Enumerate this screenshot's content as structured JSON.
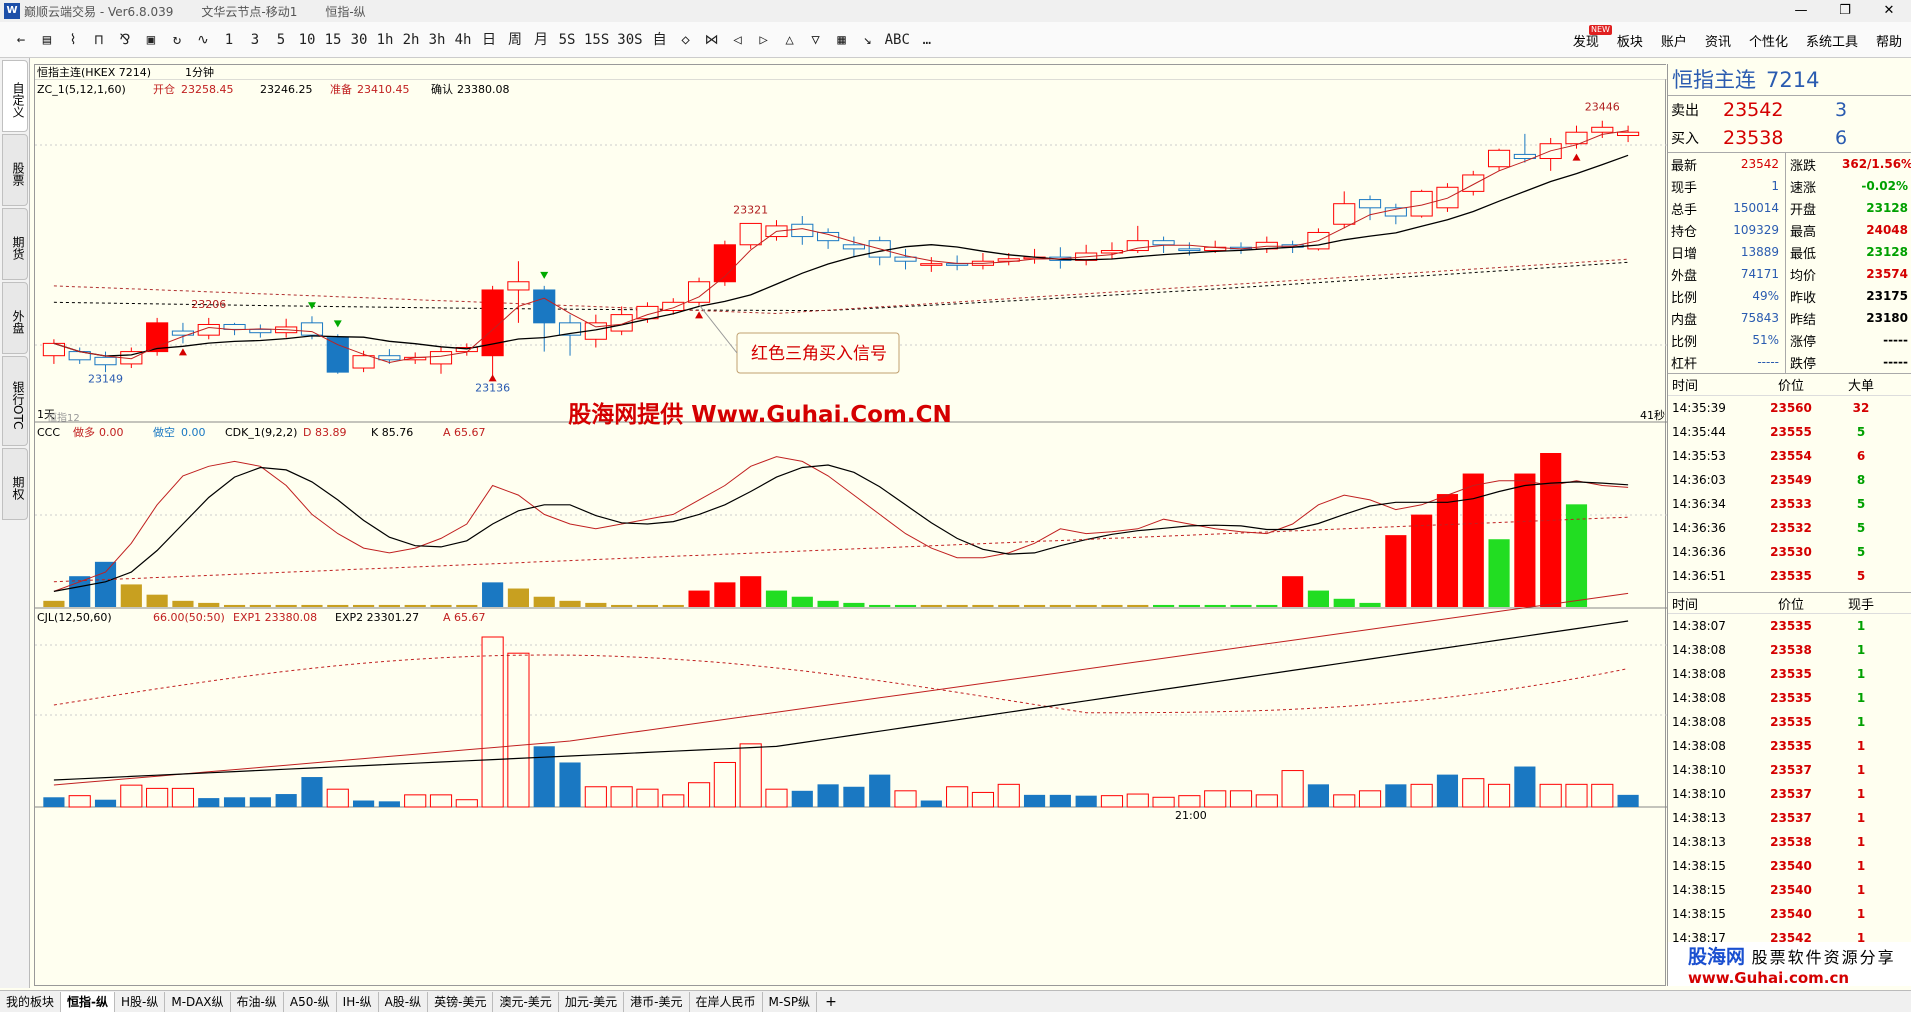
{
  "window": {
    "app_title": "巅顺云端交易 - Ver6.8.039",
    "account": "文华云节点-移动1",
    "contract": "恒指-纵",
    "controls": [
      "—",
      "❐",
      "✕"
    ]
  },
  "toolbar": {
    "left_items": [
      "←",
      "▤",
      "⌇",
      "⊓",
      "⅋",
      "▣",
      "↻",
      "∿",
      "1",
      "3",
      "5",
      "10",
      "15",
      "30",
      "1h",
      "2h",
      "3h",
      "4h",
      "日",
      "周",
      "月",
      "5S",
      "15S",
      "30S",
      "自",
      "◇",
      "⋈",
      "◁",
      "▷",
      "△",
      "▽",
      "▦",
      "↘",
      "ABC",
      "…"
    ],
    "right_items": [
      "发现",
      "板块",
      "账户",
      "资讯",
      "个性化",
      "系统工具",
      "帮助"
    ],
    "new_badge": "NEW"
  },
  "left_tabs": [
    "自定义",
    "股票",
    "期货",
    "外盘",
    "银行OTC",
    "期权"
  ],
  "chart": {
    "header": "恒指主连(HKEX 7214)",
    "period": "1分钟",
    "main_indicator": {
      "name": "ZC_1(5,12,1,60)",
      "kaicang_label": "开仓",
      "kaicang_value": "23258.45",
      "mid_value": "23246.25",
      "zhunbei_label": "准备",
      "zhunbei_value": "23410.45",
      "queren_label": "确认",
      "queren_value": "23380.08"
    },
    "annotation": "红色三角买入信号",
    "price_labels": [
      "23446",
      "23321",
      "23206",
      "23149",
      "23136"
    ],
    "left_bottom_label": "1天",
    "left_sub_label": "恒指12",
    "right_bottom_label": "41秒",
    "watermark_center": "股海网提供 Www.Guhai.Com.CN",
    "sub1": {
      "name": "CCC",
      "zuoduo_label": "做多",
      "zuoduo_value": "0.00",
      "zuokong_label": "做空",
      "zuokong_value": "0.00",
      "cdk_name": "CDK_1(9,2,2)",
      "d_label": "D 83.89",
      "k_label": "K 85.76",
      "a_label": "A 65.67"
    },
    "sub2": {
      "name": "CJL(12,50,60)",
      "v_label": "66.00(50:50)",
      "exp1": "EXP1 23380.08",
      "exp2": "EXP2 23301.27",
      "a_label": "A 65.67"
    },
    "time_label": "21:00",
    "colors": {
      "up": "#ff0000",
      "down": "#1a78c2",
      "green": "#22dd22",
      "gold": "#c8a020"
    }
  },
  "chart_data": {
    "type": "candlestick",
    "candles": [
      {
        "o": 23160,
        "c": 23175,
        "h": 23180,
        "l": 23150
      },
      {
        "o": 23165,
        "c": 23155,
        "h": 23170,
        "l": 23150
      },
      {
        "o": 23158,
        "c": 23149,
        "h": 23165,
        "l": 23140
      },
      {
        "o": 23150,
        "c": 23165,
        "h": 23170,
        "l": 23145
      },
      {
        "o": 23165,
        "c": 23200,
        "h": 23206,
        "l": 23160
      },
      {
        "o": 23190,
        "c": 23185,
        "h": 23200,
        "l": 23175
      },
      {
        "o": 23185,
        "c": 23198,
        "h": 23206,
        "l": 23180
      },
      {
        "o": 23198,
        "c": 23192,
        "h": 23200,
        "l": 23185
      },
      {
        "o": 23192,
        "c": 23188,
        "h": 23198,
        "l": 23182
      },
      {
        "o": 23188,
        "c": 23195,
        "h": 23205,
        "l": 23182
      },
      {
        "o": 23200,
        "c": 23185,
        "h": 23208,
        "l": 23180
      },
      {
        "o": 23182,
        "c": 23140,
        "h": 23186,
        "l": 23138
      },
      {
        "o": 23145,
        "c": 23160,
        "h": 23166,
        "l": 23140
      },
      {
        "o": 23160,
        "c": 23155,
        "h": 23168,
        "l": 23150
      },
      {
        "o": 23155,
        "c": 23158,
        "h": 23164,
        "l": 23150
      },
      {
        "o": 23150,
        "c": 23165,
        "h": 23170,
        "l": 23138
      },
      {
        "o": 23165,
        "c": 23170,
        "h": 23175,
        "l": 23160
      },
      {
        "o": 23160,
        "c": 23240,
        "h": 23245,
        "l": 23136
      },
      {
        "o": 23240,
        "c": 23250,
        "h": 23275,
        "l": 23200
      },
      {
        "o": 23240,
        "c": 23200,
        "h": 23245,
        "l": 23165
      },
      {
        "o": 23200,
        "c": 23185,
        "h": 23210,
        "l": 23160
      },
      {
        "o": 23180,
        "c": 23200,
        "h": 23210,
        "l": 23170
      },
      {
        "o": 23190,
        "c": 23210,
        "h": 23220,
        "l": 23185
      },
      {
        "o": 23205,
        "c": 23220,
        "h": 23225,
        "l": 23200
      },
      {
        "o": 23215,
        "c": 23225,
        "h": 23230,
        "l": 23210
      },
      {
        "o": 23225,
        "c": 23250,
        "h": 23255,
        "l": 23220
      },
      {
        "o": 23250,
        "c": 23295,
        "h": 23300,
        "l": 23245
      },
      {
        "o": 23295,
        "c": 23321,
        "h": 23321,
        "l": 23290
      },
      {
        "o": 23305,
        "c": 23318,
        "h": 23325,
        "l": 23300
      },
      {
        "o": 23320,
        "c": 23305,
        "h": 23330,
        "l": 23295
      },
      {
        "o": 23310,
        "c": 23300,
        "h": 23315,
        "l": 23290
      },
      {
        "o": 23295,
        "c": 23290,
        "h": 23305,
        "l": 23280
      },
      {
        "o": 23300,
        "c": 23280,
        "h": 23305,
        "l": 23270
      },
      {
        "o": 23280,
        "c": 23275,
        "h": 23290,
        "l": 23265
      },
      {
        "o": 23270,
        "c": 23272,
        "h": 23280,
        "l": 23262
      },
      {
        "o": 23272,
        "c": 23270,
        "h": 23282,
        "l": 23264
      },
      {
        "o": 23270,
        "c": 23275,
        "h": 23285,
        "l": 23265
      },
      {
        "o": 23275,
        "c": 23278,
        "h": 23285,
        "l": 23270
      },
      {
        "o": 23278,
        "c": 23280,
        "h": 23290,
        "l": 23272
      },
      {
        "o": 23280,
        "c": 23276,
        "h": 23292,
        "l": 23266
      },
      {
        "o": 23276,
        "c": 23285,
        "h": 23295,
        "l": 23270
      },
      {
        "o": 23285,
        "c": 23288,
        "h": 23298,
        "l": 23278
      },
      {
        "o": 23288,
        "c": 23300,
        "h": 23318,
        "l": 23285
      },
      {
        "o": 23300,
        "c": 23295,
        "h": 23305,
        "l": 23285
      },
      {
        "o": 23290,
        "c": 23288,
        "h": 23298,
        "l": 23282
      },
      {
        "o": 23288,
        "c": 23292,
        "h": 23300,
        "l": 23285
      },
      {
        "o": 23292,
        "c": 23290,
        "h": 23298,
        "l": 23284
      },
      {
        "o": 23290,
        "c": 23298,
        "h": 23305,
        "l": 23285
      },
      {
        "o": 23295,
        "c": 23292,
        "h": 23300,
        "l": 23285
      },
      {
        "o": 23290,
        "c": 23310,
        "h": 23315,
        "l": 23288
      },
      {
        "o": 23320,
        "c": 23345,
        "h": 23360,
        "l": 23315
      },
      {
        "o": 23350,
        "c": 23340,
        "h": 23355,
        "l": 23325
      },
      {
        "o": 23340,
        "c": 23330,
        "h": 23345,
        "l": 23320
      },
      {
        "o": 23330,
        "c": 23360,
        "h": 23362,
        "l": 23328
      },
      {
        "o": 23340,
        "c": 23365,
        "h": 23370,
        "l": 23335
      },
      {
        "o": 23360,
        "c": 23380,
        "h": 23385,
        "l": 23355
      },
      {
        "o": 23390,
        "c": 23410,
        "h": 23412,
        "l": 23385
      },
      {
        "o": 23405,
        "c": 23400,
        "h": 23430,
        "l": 23395
      },
      {
        "o": 23400,
        "c": 23418,
        "h": 23425,
        "l": 23385
      },
      {
        "o": 23418,
        "c": 23432,
        "h": 23440,
        "l": 23412
      },
      {
        "o": 23432,
        "c": 23438,
        "h": 23446,
        "l": 23425
      },
      {
        "o": 23428,
        "c": 23432,
        "h": 23440,
        "l": 23420
      }
    ],
    "sub1_bars": [
      {
        "v": 3,
        "c": "gold"
      },
      {
        "v": 15,
        "c": "down"
      },
      {
        "v": 22,
        "c": "down"
      },
      {
        "v": 11,
        "c": "gold"
      },
      {
        "v": 6,
        "c": "gold"
      },
      {
        "v": 3,
        "c": "gold"
      },
      {
        "v": 2,
        "c": "gold"
      },
      {
        "v": 1,
        "c": "gold"
      },
      {
        "v": 1,
        "c": "gold"
      },
      {
        "v": 1,
        "c": "gold"
      },
      {
        "v": 1,
        "c": "gold"
      },
      {
        "v": 1,
        "c": "gold"
      },
      {
        "v": 1,
        "c": "gold"
      },
      {
        "v": 1,
        "c": "gold"
      },
      {
        "v": 1,
        "c": "gold"
      },
      {
        "v": 1,
        "c": "gold"
      },
      {
        "v": 1,
        "c": "gold"
      },
      {
        "v": 12,
        "c": "down"
      },
      {
        "v": 9,
        "c": "gold"
      },
      {
        "v": 5,
        "c": "gold"
      },
      {
        "v": 3,
        "c": "gold"
      },
      {
        "v": 2,
        "c": "gold"
      },
      {
        "v": 1,
        "c": "gold"
      },
      {
        "v": 1,
        "c": "gold"
      },
      {
        "v": 1,
        "c": "gold"
      },
      {
        "v": 8,
        "c": "up"
      },
      {
        "v": 12,
        "c": "up"
      },
      {
        "v": 15,
        "c": "up"
      },
      {
        "v": 8,
        "c": "green"
      },
      {
        "v": 5,
        "c": "green"
      },
      {
        "v": 3,
        "c": "green"
      },
      {
        "v": 2,
        "c": "green"
      },
      {
        "v": 1,
        "c": "green"
      },
      {
        "v": 1,
        "c": "green"
      },
      {
        "v": 1,
        "c": "gold"
      },
      {
        "v": 1,
        "c": "gold"
      },
      {
        "v": 1,
        "c": "gold"
      },
      {
        "v": 1,
        "c": "gold"
      },
      {
        "v": 1,
        "c": "gold"
      },
      {
        "v": 1,
        "c": "gold"
      },
      {
        "v": 1,
        "c": "gold"
      },
      {
        "v": 1,
        "c": "gold"
      },
      {
        "v": 1,
        "c": "gold"
      },
      {
        "v": 1,
        "c": "green"
      },
      {
        "v": 1,
        "c": "green"
      },
      {
        "v": 1,
        "c": "green"
      },
      {
        "v": 1,
        "c": "green"
      },
      {
        "v": 1,
        "c": "green"
      },
      {
        "v": 15,
        "c": "up"
      },
      {
        "v": 8,
        "c": "green"
      },
      {
        "v": 4,
        "c": "green"
      },
      {
        "v": 2,
        "c": "green"
      },
      {
        "v": 35,
        "c": "up"
      },
      {
        "v": 45,
        "c": "up"
      },
      {
        "v": 55,
        "c": "up"
      },
      {
        "v": 65,
        "c": "up"
      },
      {
        "v": 33,
        "c": "green"
      },
      {
        "v": 65,
        "c": "up"
      },
      {
        "v": 75,
        "c": "up"
      },
      {
        "v": 50,
        "c": "green"
      }
    ],
    "sub2_vols": [
      {
        "v": 12,
        "c": "down"
      },
      {
        "v": 14,
        "c": "hollow"
      },
      {
        "v": 9,
        "c": "down"
      },
      {
        "v": 27,
        "c": "hollow"
      },
      {
        "v": 23,
        "c": "hollow"
      },
      {
        "v": 23,
        "c": "hollow"
      },
      {
        "v": 11,
        "c": "down"
      },
      {
        "v": 12,
        "c": "down"
      },
      {
        "v": 12,
        "c": "down"
      },
      {
        "v": 16,
        "c": "down"
      },
      {
        "v": 37,
        "c": "down"
      },
      {
        "v": 22,
        "c": "hollow"
      },
      {
        "v": 8,
        "c": "down"
      },
      {
        "v": 7,
        "c": "down"
      },
      {
        "v": 15,
        "c": "hollow"
      },
      {
        "v": 15,
        "c": "hollow"
      },
      {
        "v": 9,
        "c": "hollow"
      },
      {
        "v": 210,
        "c": "hollow"
      },
      {
        "v": 190,
        "c": "hollow"
      },
      {
        "v": 75,
        "c": "down"
      },
      {
        "v": 55,
        "c": "down"
      },
      {
        "v": 25,
        "c": "hollow"
      },
      {
        "v": 25,
        "c": "hollow"
      },
      {
        "v": 22,
        "c": "hollow"
      },
      {
        "v": 15,
        "c": "hollow"
      },
      {
        "v": 30,
        "c": "hollow"
      },
      {
        "v": 55,
        "c": "hollow"
      },
      {
        "v": 78,
        "c": "hollow"
      },
      {
        "v": 22,
        "c": "hollow"
      },
      {
        "v": 20,
        "c": "down"
      },
      {
        "v": 28,
        "c": "down"
      },
      {
        "v": 25,
        "c": "down"
      },
      {
        "v": 40,
        "c": "down"
      },
      {
        "v": 20,
        "c": "hollow"
      },
      {
        "v": 8,
        "c": "down"
      },
      {
        "v": 25,
        "c": "hollow"
      },
      {
        "v": 18,
        "c": "hollow"
      },
      {
        "v": 28,
        "c": "hollow"
      },
      {
        "v": 15,
        "c": "down"
      },
      {
        "v": 15,
        "c": "down"
      },
      {
        "v": 14,
        "c": "down"
      },
      {
        "v": 14,
        "c": "hollow"
      },
      {
        "v": 16,
        "c": "hollow"
      },
      {
        "v": 12,
        "c": "hollow"
      },
      {
        "v": 14,
        "c": "hollow"
      },
      {
        "v": 20,
        "c": "hollow"
      },
      {
        "v": 20,
        "c": "hollow"
      },
      {
        "v": 15,
        "c": "hollow"
      },
      {
        "v": 45,
        "c": "hollow"
      },
      {
        "v": 28,
        "c": "down"
      },
      {
        "v": 15,
        "c": "hollow"
      },
      {
        "v": 20,
        "c": "hollow"
      },
      {
        "v": 28,
        "c": "down"
      },
      {
        "v": 28,
        "c": "hollow"
      },
      {
        "v": 40,
        "c": "down"
      },
      {
        "v": 35,
        "c": "hollow"
      },
      {
        "v": 28,
        "c": "hollow"
      },
      {
        "v": 50,
        "c": "down"
      },
      {
        "v": 28,
        "c": "hollow"
      },
      {
        "v": 28,
        "c": "hollow"
      },
      {
        "v": 28,
        "c": "hollow"
      },
      {
        "v": 15,
        "c": "down"
      }
    ]
  },
  "quote": {
    "name": "恒指主连",
    "code": "7214",
    "sell_label": "卖出",
    "sell_price": "23542",
    "sell_vol": "3",
    "buy_label": "买入",
    "buy_price": "23538",
    "buy_vol": "6",
    "rows": [
      {
        "k1": "最新",
        "v1": "23542",
        "c1": "#d40000",
        "k2": "涨跌",
        "v2": "362/1.56%",
        "c2": "#d40000"
      },
      {
        "k1": "现手",
        "v1": "1",
        "c1": "#2a5bb0",
        "k2": "速涨",
        "v2": "-0.02%",
        "c2": "#00a000"
      },
      {
        "k1": "总手",
        "v1": "150014",
        "c1": "#2a5bb0",
        "k2": "开盘",
        "v2": "23128",
        "c2": "#00a000"
      },
      {
        "k1": "持仓",
        "v1": "109329",
        "c1": "#2a5bb0",
        "k2": "最高",
        "v2": "24048",
        "c2": "#d40000"
      },
      {
        "k1": "日增",
        "v1": "13889",
        "c1": "#2a5bb0",
        "k2": "最低",
        "v2": "23128",
        "c2": "#00a000"
      },
      {
        "k1": "外盘",
        "v1": "74171",
        "c1": "#2a5bb0",
        "k2": "均价",
        "v2": "23574",
        "c2": "#d40000"
      },
      {
        "k1": "比例",
        "v1": "49%",
        "c1": "#2a5bb0",
        "k2": "昨收",
        "v2": "23175",
        "c2": "#000000"
      },
      {
        "k1": "内盘",
        "v1": "75843",
        "c1": "#2a5bb0",
        "k2": "昨结",
        "v2": "23180",
        "c2": "#000000"
      },
      {
        "k1": "比例",
        "v1": "51%",
        "c1": "#2a5bb0",
        "k2": "涨停",
        "v2": "-----",
        "c2": "#000000"
      },
      {
        "k1": "杠杆",
        "v1": "-----",
        "c1": "#2a5bb0",
        "k2": "跌停",
        "v2": "-----",
        "c2": "#000000"
      }
    ],
    "big_head": [
      "时间",
      "价位",
      "大单"
    ],
    "big_trades": [
      {
        "t": "14:35:39",
        "p": "23560",
        "v": "32",
        "vc": "#d40000"
      },
      {
        "t": "14:35:44",
        "p": "23555",
        "v": "5",
        "vc": "#00a000"
      },
      {
        "t": "14:35:53",
        "p": "23554",
        "v": "6",
        "vc": "#d40000"
      },
      {
        "t": "14:36:03",
        "p": "23549",
        "v": "8",
        "vc": "#00a000"
      },
      {
        "t": "14:36:34",
        "p": "23533",
        "v": "5",
        "vc": "#00a000"
      },
      {
        "t": "14:36:36",
        "p": "23532",
        "v": "5",
        "vc": "#00a000"
      },
      {
        "t": "14:36:36",
        "p": "23530",
        "v": "5",
        "vc": "#00a000"
      },
      {
        "t": "14:36:51",
        "p": "23535",
        "v": "5",
        "vc": "#d40000"
      }
    ],
    "tick_head": [
      "时间",
      "价位",
      "现手"
    ],
    "ticks": [
      {
        "t": "14:38:07",
        "p": "23535",
        "v": "1",
        "vc": "#00a000"
      },
      {
        "t": "14:38:08",
        "p": "23538",
        "v": "1",
        "vc": "#00a000"
      },
      {
        "t": "14:38:08",
        "p": "23535",
        "v": "1",
        "vc": "#00a000"
      },
      {
        "t": "14:38:08",
        "p": "23535",
        "v": "1",
        "vc": "#00a000"
      },
      {
        "t": "14:38:08",
        "p": "23535",
        "v": "1",
        "vc": "#00a000"
      },
      {
        "t": "14:38:08",
        "p": "23535",
        "v": "1",
        "vc": "#d40000"
      },
      {
        "t": "14:38:10",
        "p": "23537",
        "v": "1",
        "vc": "#d40000"
      },
      {
        "t": "14:38:10",
        "p": "23537",
        "v": "1",
        "vc": "#d40000"
      },
      {
        "t": "14:38:13",
        "p": "23537",
        "v": "1",
        "vc": "#d40000"
      },
      {
        "t": "14:38:13",
        "p": "23538",
        "v": "1",
        "vc": "#d40000"
      },
      {
        "t": "14:38:15",
        "p": "23540",
        "v": "1",
        "vc": "#d40000"
      },
      {
        "t": "14:38:15",
        "p": "23540",
        "v": "1",
        "vc": "#d40000"
      },
      {
        "t": "14:38:15",
        "p": "23540",
        "v": "1",
        "vc": "#d40000"
      },
      {
        "t": "14:38:17",
        "p": "23542",
        "v": "1",
        "vc": "#d40000"
      }
    ],
    "watermark_brand": "股海网",
    "watermark_slogan": "股票软件资源分享",
    "watermark_url": "www.Guhai.com.cn"
  },
  "bottom_tabs": [
    "我的板块",
    "恒指-纵",
    "H股-纵",
    "M-DAX纵",
    "布油-纵",
    "A50-纵",
    "IH-纵",
    "A股-纵",
    "英镑-美元",
    "澳元-美元",
    "加元-美元",
    "港币-美元",
    "在岸人民币",
    "M-SP纵"
  ],
  "bottom_active": 1,
  "bottom_plus": "+"
}
